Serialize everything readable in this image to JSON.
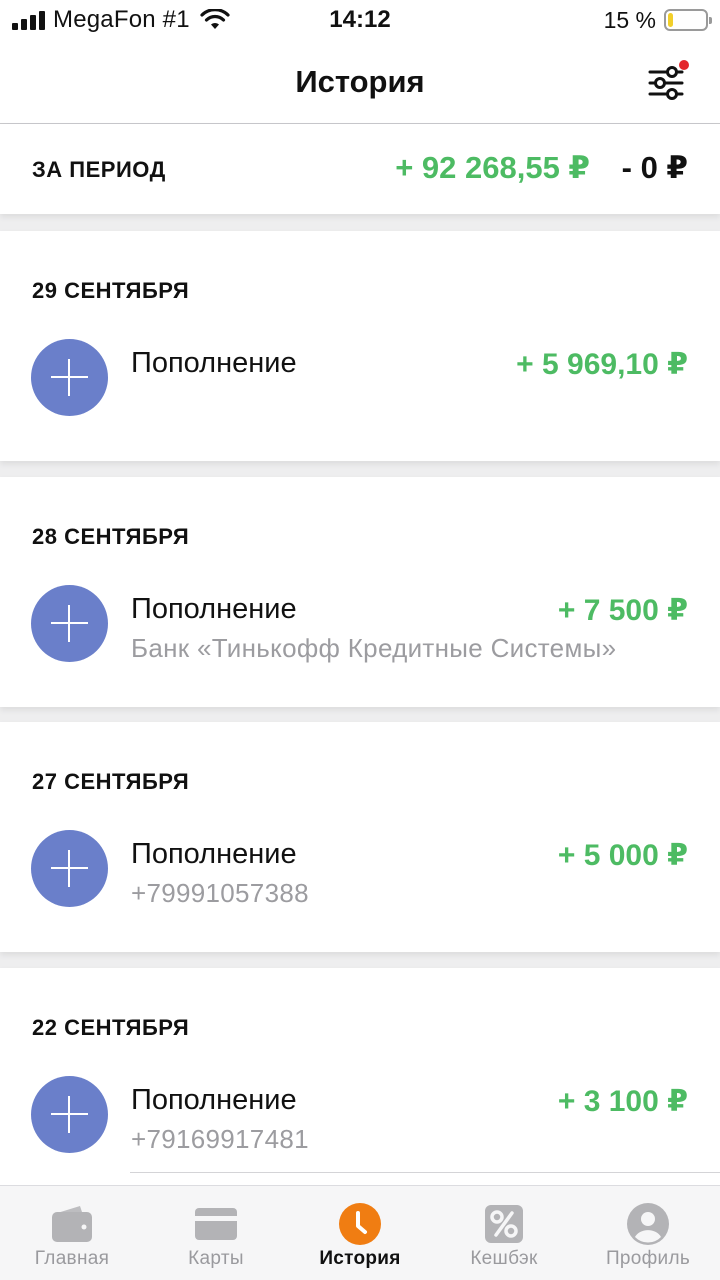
{
  "status_bar": {
    "carrier": "MegaFon #1",
    "time": "14:12",
    "battery": "15 %",
    "battery_level": 0.15
  },
  "header": {
    "title": "История"
  },
  "period": {
    "label": "ЗА ПЕРИОД",
    "income": "+ 92 268,55 ₽",
    "expense": "- 0 ₽"
  },
  "days": [
    {
      "date": "29 СЕНТЯБРЯ",
      "tx": {
        "title": "Пополнение",
        "subtitle": "",
        "amount": "+ 5 969,10 ₽"
      }
    },
    {
      "date": "28 СЕНТЯБРЯ",
      "tx": {
        "title": "Пополнение",
        "subtitle": "Банк «Тинькофф Кредитные Системы»",
        "amount": "+ 7 500 ₽"
      }
    },
    {
      "date": "27 СЕНТЯБРЯ",
      "tx": {
        "title": "Пополнение",
        "subtitle": "+79991057388",
        "amount": "+ 5 000 ₽"
      }
    },
    {
      "date": "22 СЕНТЯБРЯ",
      "tx": {
        "title": "Пополнение",
        "subtitle": "+79169917481",
        "amount": "+ 3 100 ₽"
      }
    }
  ],
  "tabs": [
    {
      "label": "Главная",
      "icon": "wallet-icon"
    },
    {
      "label": "Карты",
      "icon": "card-icon"
    },
    {
      "label": "История",
      "icon": "clock-icon",
      "active": true
    },
    {
      "label": "Кешбэк",
      "icon": "percent-icon"
    },
    {
      "label": "Профиль",
      "icon": "profile-icon"
    }
  ],
  "colors": {
    "income": "#4dbb63",
    "icon_bg": "#6a7fca",
    "active_tab": "#f07d12",
    "badge": "#e3262b"
  }
}
